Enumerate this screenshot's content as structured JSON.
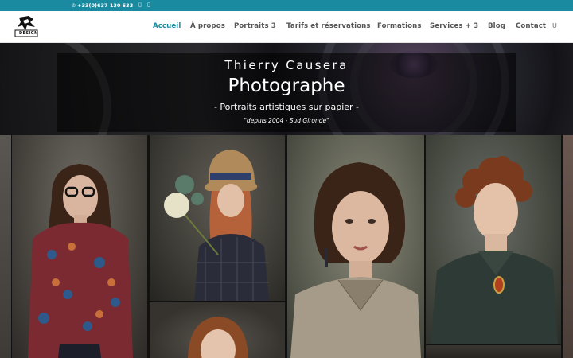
{
  "topbar": {
    "phone": "+33(0)637 130 533",
    "phone_icon": "phone-icon",
    "facebook_icon": "facebook-icon",
    "instagram_icon": "instagram-icon"
  },
  "header": {
    "logo_text": "DESIGN",
    "nav": [
      {
        "label": "Accueil",
        "active": true
      },
      {
        "label": "À propos"
      },
      {
        "label": "Portraits 3"
      },
      {
        "label": "Tarifs et réservations"
      },
      {
        "label": "Formations"
      },
      {
        "label": "Services + 3"
      },
      {
        "label": "Blog"
      },
      {
        "label": "Contact"
      }
    ],
    "search_glyph": "U"
  },
  "hero": {
    "name": "Thierry Causera",
    "title": "Photographe",
    "subtitle": "- Portraits artistiques sur papier  -",
    "since": "\"depuis 2004 - Sud Gironde\""
  },
  "colors": {
    "accent": "#1a8aa0",
    "nav_text": "#555555",
    "topbar_bg": "#1a8aa0"
  }
}
